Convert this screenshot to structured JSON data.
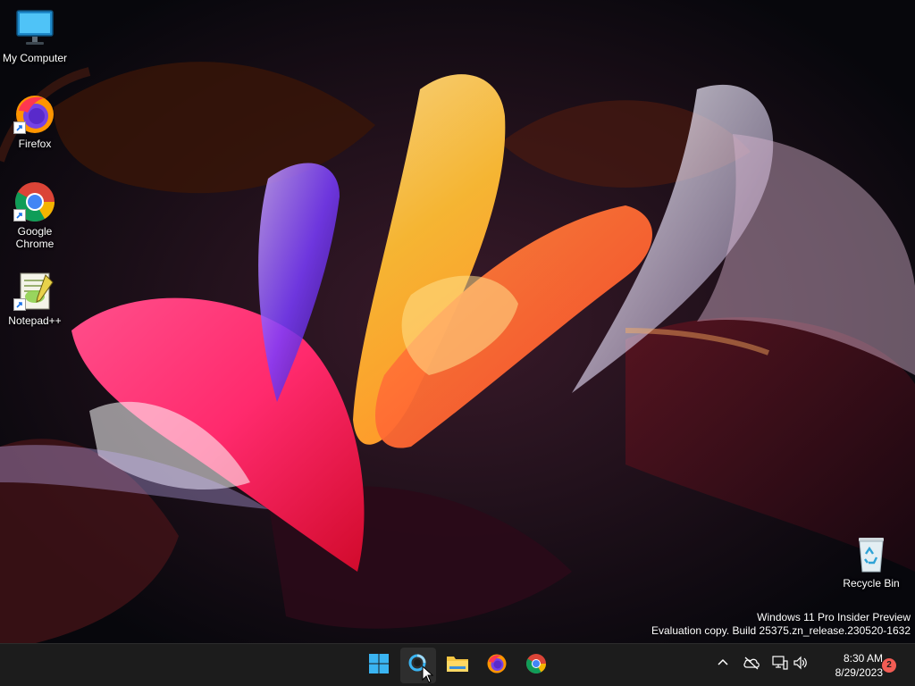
{
  "desktop": {
    "icons": [
      {
        "label": "My Computer",
        "icon": "monitor-icon"
      },
      {
        "label": "Firefox",
        "icon": "firefox-icon"
      },
      {
        "label": "Google Chrome",
        "icon": "chrome-icon"
      },
      {
        "label": "Notepad++",
        "icon": "notepadpp-icon"
      },
      {
        "label": "Recycle Bin",
        "icon": "recycle-bin-icon"
      }
    ],
    "watermark": {
      "line1": "Windows 11 Pro Insider Preview",
      "line2": "Evaluation copy. Build 25375.zn_release.230520-1632"
    }
  },
  "taskbar": {
    "apps": [
      {
        "icon": "windows-start-icon",
        "active": false
      },
      {
        "icon": "search-icon",
        "active": true
      },
      {
        "icon": "file-explorer-icon",
        "active": false
      },
      {
        "icon": "firefox-icon",
        "active": false
      },
      {
        "icon": "chrome-icon",
        "active": false
      }
    ],
    "tray": {
      "icons": [
        "chevron-up-icon",
        "cloud-offline-icon",
        "network-icon",
        "volume-icon"
      ],
      "time": "8:30 AM",
      "date": "8/29/2023",
      "notification_count": "2"
    }
  },
  "colors": {
    "taskbar_bg": "#1c1c1c",
    "notification_badge": "#f25c54",
    "wallpaper_base": "#07070c"
  }
}
